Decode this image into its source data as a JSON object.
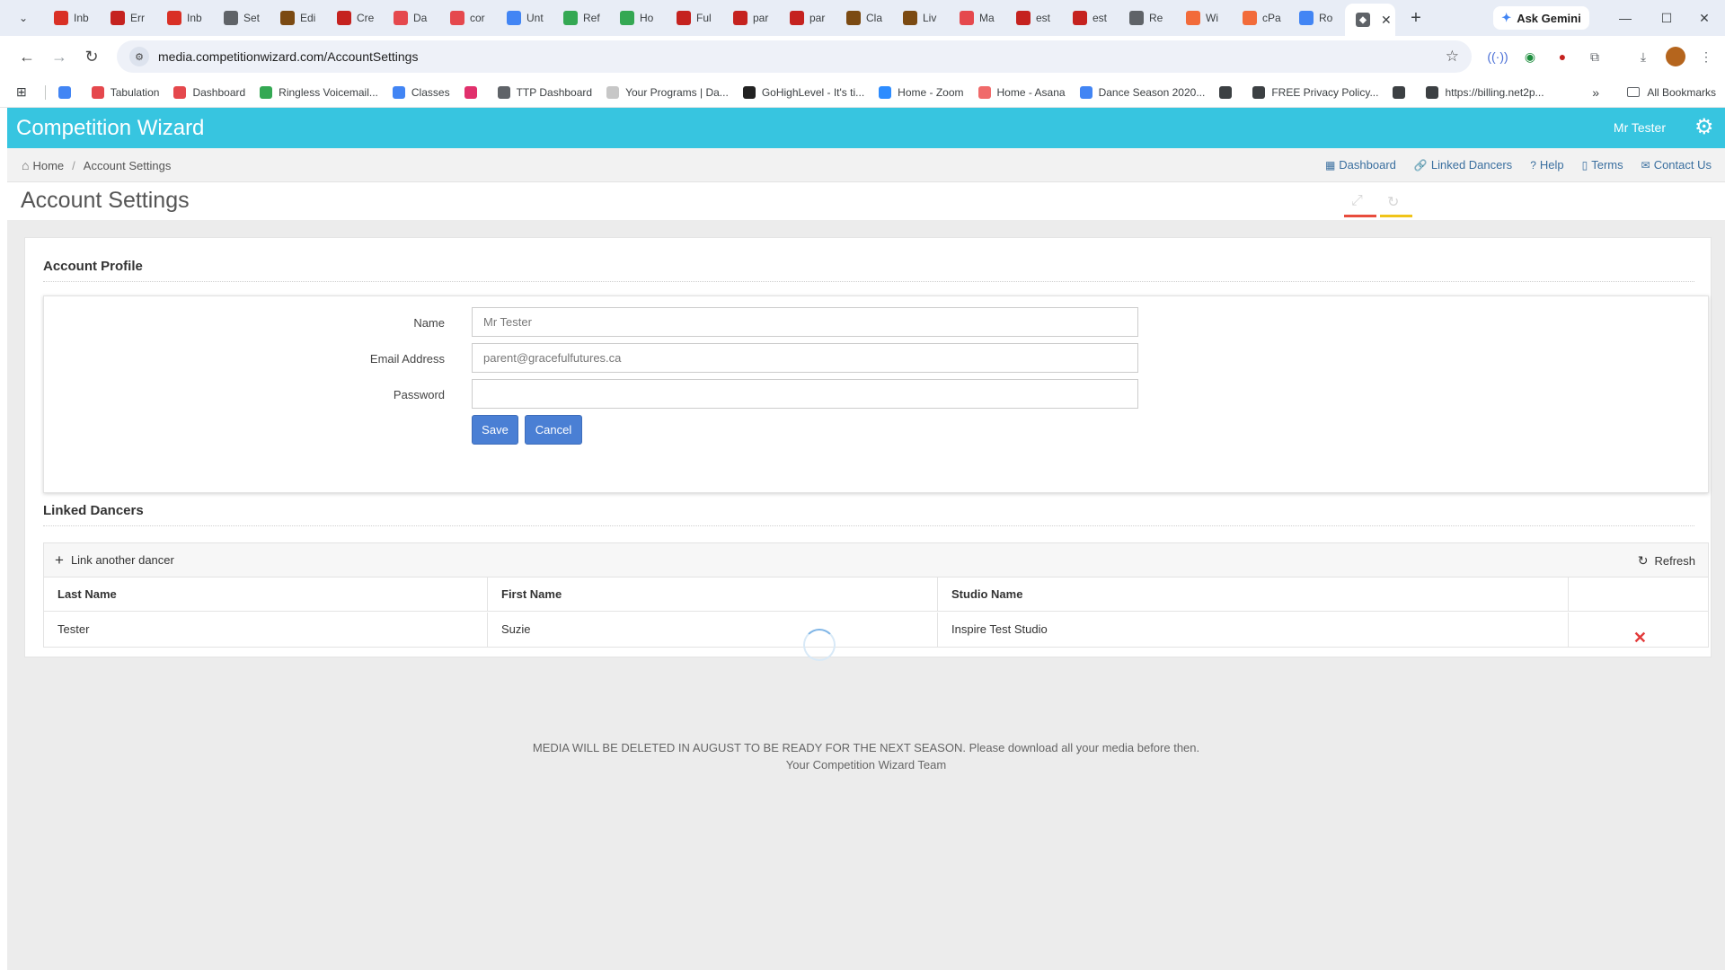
{
  "browser": {
    "tabs": [
      {
        "label": "Inb",
        "color": "#d93025"
      },
      {
        "label": "Err",
        "color": "#c5221f"
      },
      {
        "label": "Inb",
        "color": "#d93025"
      },
      {
        "label": "Set",
        "color": "#5f6368"
      },
      {
        "label": "Edi",
        "color": "#7b4a12"
      },
      {
        "label": "Cre",
        "color": "#c5221f"
      },
      {
        "label": "Da",
        "color": "#e5484d"
      },
      {
        "label": "cor",
        "color": "#e5484d"
      },
      {
        "label": "Unt",
        "color": "#4285f4"
      },
      {
        "label": "Ref",
        "color": "#34a853"
      },
      {
        "label": "Ho",
        "color": "#34a853"
      },
      {
        "label": "Ful",
        "color": "#c5221f"
      },
      {
        "label": "par",
        "color": "#c5221f"
      },
      {
        "label": "par",
        "color": "#c5221f"
      },
      {
        "label": "Cla",
        "color": "#7b4a12"
      },
      {
        "label": "Liv",
        "color": "#7b4a12"
      },
      {
        "label": "Ma",
        "color": "#e5484d"
      },
      {
        "label": "est",
        "color": "#c5221f"
      },
      {
        "label": "est",
        "color": "#c5221f"
      },
      {
        "label": "Re",
        "color": "#5f6368"
      },
      {
        "label": "Wi",
        "color": "#f26b3a"
      },
      {
        "label": "cPa",
        "color": "#f26b3a"
      },
      {
        "label": "Ro",
        "color": "#4285f4"
      }
    ],
    "active_tab_close": "✕",
    "new_tab": "+",
    "gemini_label": "Ask Gemini",
    "url": "media.competitionwizard.com/AccountSettings",
    "bookmarks": [
      {
        "label": "Tabulation",
        "color": "#e5484d"
      },
      {
        "label": "Dashboard",
        "color": "#e5484d"
      },
      {
        "label": "Ringless Voicemail...",
        "color": "#34a853"
      },
      {
        "label": "Classes",
        "color": "#4285f4"
      },
      {
        "label": "",
        "color": "#e1306c"
      },
      {
        "label": "TTP Dashboard",
        "color": "#5f6368"
      },
      {
        "label": "Your Programs | Da...",
        "color": "#c7c7c7"
      },
      {
        "label": "GoHighLevel - It's ti...",
        "color": "#222222"
      },
      {
        "label": "Home - Zoom",
        "color": "#2d8cff"
      },
      {
        "label": "Home - Asana",
        "color": "#f06a6a"
      },
      {
        "label": "Dance Season 2020...",
        "color": "#4285f4"
      },
      {
        "label": "",
        "color": "#3c4043"
      },
      {
        "label": "FREE Privacy Policy...",
        "color": "#3c4043"
      },
      {
        "label": "",
        "color": "#3c4043"
      },
      {
        "label": "https://billing.net2p...",
        "color": "#3c4043"
      }
    ],
    "all_bookmarks": "All Bookmarks",
    "more_bookmarks": "»"
  },
  "app": {
    "brand": "Competition Wizard",
    "user_name": "Mr Tester",
    "header_color": "#37c5e0",
    "breadcrumb": {
      "home": "Home",
      "separator": "/",
      "current": "Account Settings"
    },
    "top_links": [
      {
        "icon": "dashboard-icon",
        "glyph": "▦",
        "label": "Dashboard"
      },
      {
        "icon": "link-icon",
        "glyph": "🔗",
        "label": "Linked Dancers"
      },
      {
        "icon": "help-icon",
        "glyph": "?",
        "label": "Help"
      },
      {
        "icon": "document-icon",
        "glyph": "▯",
        "label": "Terms"
      },
      {
        "icon": "envelope-icon",
        "glyph": "✉",
        "label": "Contact Us"
      }
    ],
    "page_title": "Account Settings",
    "profile": {
      "section_title": "Account Profile",
      "name_label": "Name",
      "name_value": "Mr Tester",
      "email_label": "Email Address",
      "email_value": "parent@gracefulfutures.ca",
      "password_label": "Password",
      "password_value": "",
      "save_label": "Save",
      "cancel_label": "Cancel"
    },
    "linked": {
      "section_title": "Linked Dancers",
      "link_another_label": "Link another dancer",
      "refresh_label": "Refresh",
      "columns": [
        "Last Name",
        "First Name",
        "Studio Name",
        ""
      ],
      "rows": [
        {
          "last": "Tester",
          "first": "Suzie",
          "studio": "Inspire Test Studio",
          "delete": "✕"
        }
      ]
    },
    "footer_line1": "MEDIA WILL BE DELETED IN AUGUST TO BE READY FOR THE NEXT SEASON. Please download all your media before then.",
    "footer_line2": "Your Competition Wizard Team",
    "accent_colors": [
      "#e84c3d",
      "#f0c419"
    ]
  }
}
